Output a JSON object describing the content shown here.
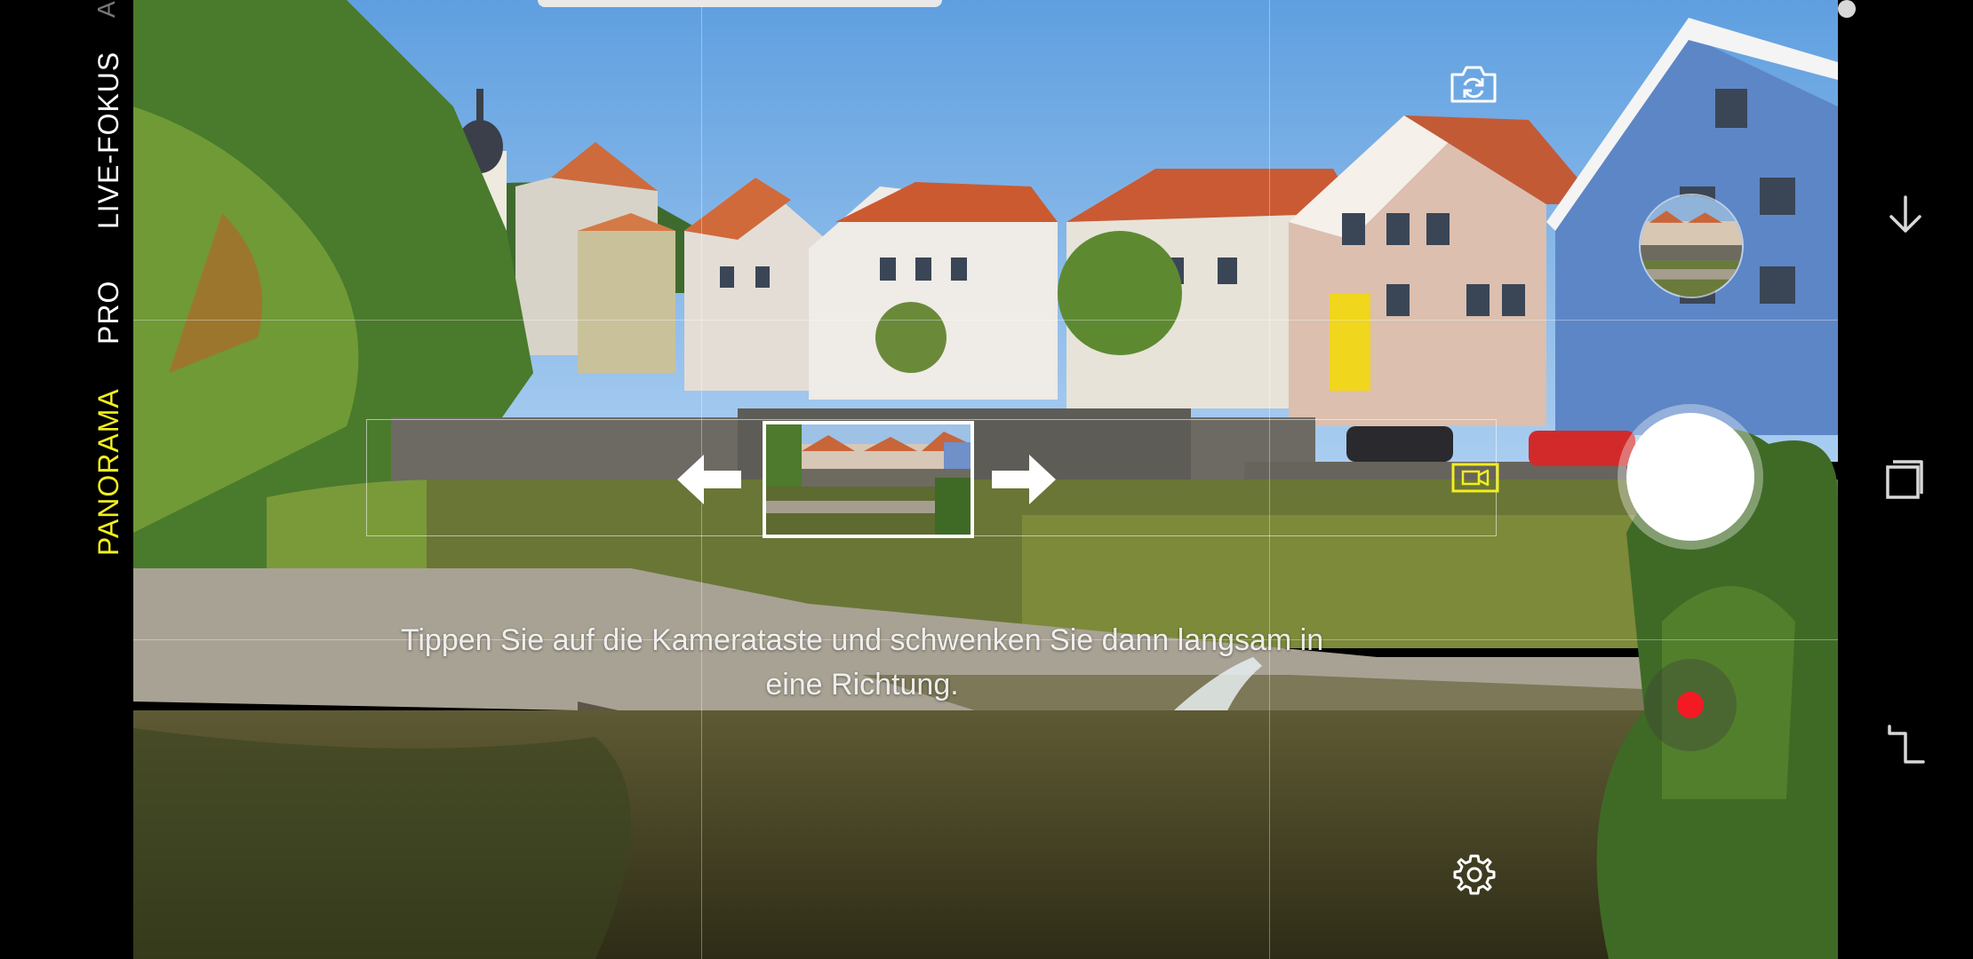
{
  "modes": {
    "top_partial": "A",
    "live_focus": "LIVE-FOKUS",
    "pro": "PRO",
    "panorama": "PANORAMA",
    "selected": "PANORAMA"
  },
  "hint": {
    "line1": "Tippen Sie auf die Kamerataste und schwenken Sie dann langsam in",
    "line2": "eine Richtung."
  },
  "icons": {
    "switch_camera": "switch-camera-icon",
    "settings": "gear-icon",
    "video_mode": "video-camera-icon",
    "arrow_left": "arrow-left-icon",
    "arrow_right": "arrow-right-icon",
    "nav_down": "arrow-down-icon",
    "nav_recent": "recent-apps-icon",
    "nav_back": "back-icon",
    "nav_home": "home-dot-icon"
  },
  "colors": {
    "selected_mode": "#f2ee1f",
    "record": "#f31a24",
    "shutter": "#ffffff",
    "video_icon": "#f2ee1f"
  }
}
